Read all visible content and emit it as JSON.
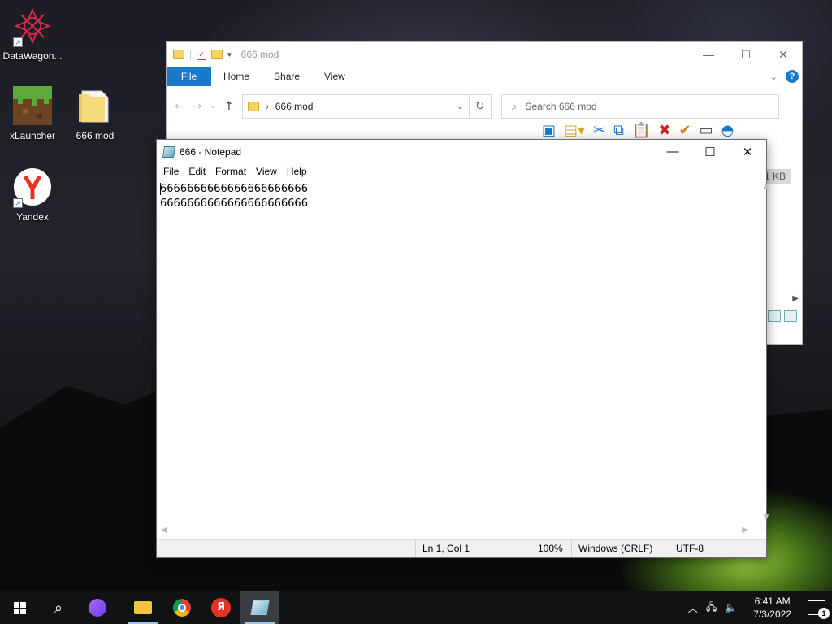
{
  "desktop": {
    "icons": [
      {
        "label": "DataWagon..."
      },
      {
        "label": "xLauncher"
      },
      {
        "label": "666 mod"
      },
      {
        "label": "Yandex"
      }
    ]
  },
  "explorer": {
    "title": "666 mod",
    "tabs": {
      "file": "File",
      "home": "Home",
      "share": "Share",
      "view": "View"
    },
    "help": "?",
    "address": "666 mod",
    "search_placeholder": "Search 666 mod",
    "size": "1 KB"
  },
  "notepad": {
    "title": "666 - Notepad",
    "menu": {
      "file": "File",
      "edit": "Edit",
      "format": "Format",
      "view": "View",
      "help": "Help"
    },
    "content": "6666666666666666666666\n6666666666666666666666",
    "status": {
      "position": "Ln 1, Col 1",
      "zoom": "100%",
      "line_endings": "Windows (CRLF)",
      "encoding": "UTF-8"
    }
  },
  "taskbar": {
    "time": "6:41 AM",
    "date": "7/3/2022",
    "notifications": "1"
  }
}
